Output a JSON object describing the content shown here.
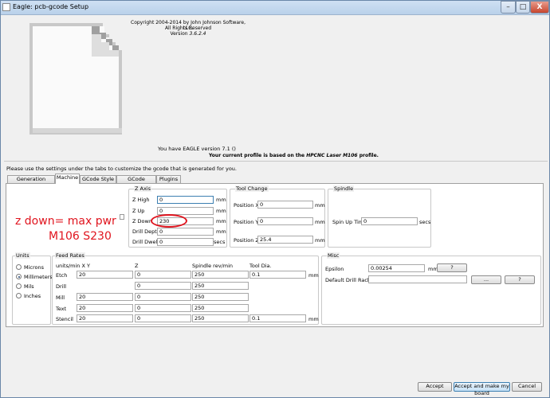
{
  "window": {
    "title": "Eagle: pcb-gcode Setup"
  },
  "caption_buttons": {
    "minimize": "–",
    "maximize": "□",
    "close": "X"
  },
  "about": {
    "copyright": "Copyright 2004-2014 by John Johnson Software, LLC.",
    "rights": "All Rights Reserved",
    "version_label": "Version",
    "version": "3.6.2.4",
    "eagle_version": "You have EAGLE version 7.1 ()",
    "profile_prefix": "Your current profile is based on the",
    "profile_name": "HPCNC Laser M106",
    "profile_suffix": "profile."
  },
  "instructions": "Please use the settings under the tabs to customize the gcode that is generated for you.",
  "tabs": [
    "Generation Options",
    "Machine",
    "GCode Style",
    "GCode Options",
    "Plugins"
  ],
  "active_tab": "Machine",
  "z_axis": {
    "title": "Z Axis",
    "rows": [
      {
        "label": "Z High",
        "value": "0",
        "unit": "mm"
      },
      {
        "label": "Z Up",
        "value": "0",
        "unit": "mm"
      },
      {
        "label": "Z Down",
        "value": "230",
        "unit": "mm"
      },
      {
        "label": "Drill Depth",
        "value": "0",
        "unit": "mm"
      },
      {
        "label": "Drill Dwell",
        "value": "0",
        "unit": "secs"
      }
    ]
  },
  "tool_change": {
    "title": "Tool Change",
    "rows": [
      {
        "label": "Position X",
        "value": "0",
        "unit": "mm"
      },
      {
        "label": "Position Y",
        "value": "0",
        "unit": "mm"
      },
      {
        "label": "Position Z",
        "value": "25.4",
        "unit": "mm"
      }
    ]
  },
  "spindle": {
    "title": "Spindle",
    "label": "Spin Up Time",
    "value": "0",
    "unit": "secs"
  },
  "units": {
    "title": "Units",
    "options": [
      "Microns",
      "Millimeters",
      "Mils",
      "Inches"
    ],
    "selected": "Millimeters"
  },
  "feed_rates": {
    "title": "Feed Rates",
    "headers": [
      "units/min  X Y",
      "Z",
      "Spindle rev/min",
      "Tool Dia."
    ],
    "rows": [
      {
        "label": "Etch",
        "xy": "20",
        "z": "0",
        "spindle": "250",
        "tool": "0.1",
        "unit": "mm"
      },
      {
        "label": "Drill",
        "xy": "",
        "z": "0",
        "spindle": "250",
        "tool": "",
        "unit": ""
      },
      {
        "label": "Mill",
        "xy": "20",
        "z": "0",
        "spindle": "250",
        "tool": "",
        "unit": ""
      },
      {
        "label": "Text",
        "xy": "20",
        "z": "0",
        "spindle": "250",
        "tool": "",
        "unit": ""
      },
      {
        "label": "Stencil",
        "xy": "20",
        "z": "0",
        "spindle": "250",
        "tool": "0.1",
        "unit": "mm"
      }
    ]
  },
  "misc": {
    "title": "Misc",
    "epsilon_label": "Epsilon",
    "epsilon_value": "0.00254",
    "epsilon_unit": "mm",
    "help": "?",
    "drill_rack_label": "Default Drill Rack File",
    "drill_rack_value": "",
    "browse": "...",
    "rack_help": "?"
  },
  "annotation": {
    "line1": "z down= max pwr",
    "line2": "M106 S230",
    "color": "#e0141e"
  },
  "footer": {
    "accept": "Accept",
    "accept_make": "Accept and make my board",
    "cancel": "Cancel"
  }
}
